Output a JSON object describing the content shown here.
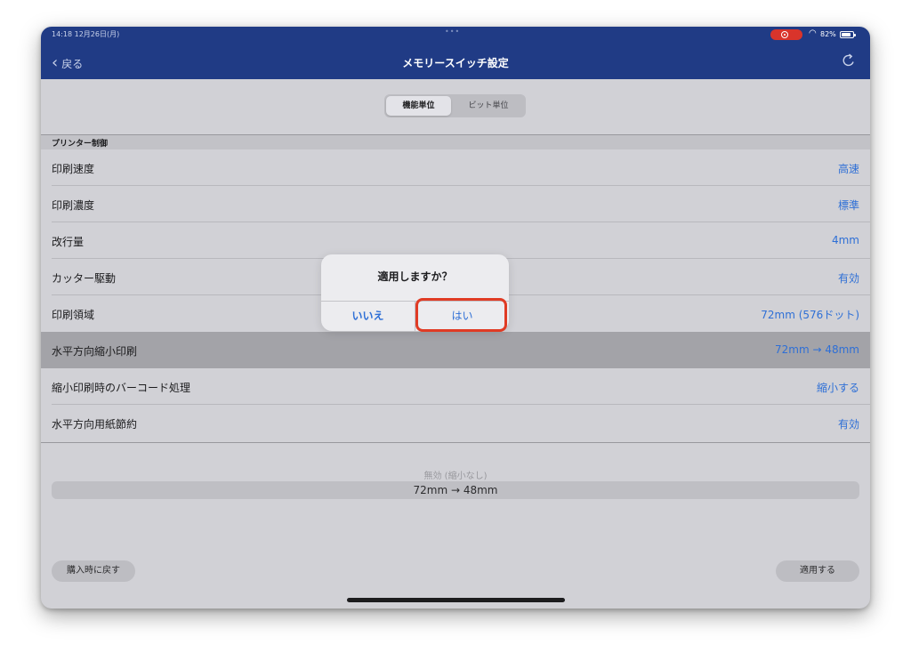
{
  "status_bar": {
    "time": "14:18  12月26日(月)",
    "dots": "•••",
    "battery": "82%"
  },
  "nav": {
    "back_label": "戻る",
    "title": "メモリースイッチ設定"
  },
  "segment": {
    "active": "機能単位",
    "inactive": "ビット単位"
  },
  "section_title": "プリンター制御",
  "rows": [
    {
      "label": "印刷速度",
      "value": "高速"
    },
    {
      "label": "印刷濃度",
      "value": "標準"
    },
    {
      "label": "改行量",
      "value": "4mm"
    },
    {
      "label": "カッター駆動",
      "value": "有効"
    },
    {
      "label": "印刷領域",
      "value": "72mm (576ドット)"
    },
    {
      "label": "水平方向縮小印刷",
      "value": "72mm → 48mm"
    },
    {
      "label": "縮小印刷時のバーコード処理",
      "value": "縮小する"
    },
    {
      "label": "水平方向用紙節約",
      "value": "有効"
    }
  ],
  "picker": {
    "faded_option": "無効 (縮小なし)",
    "selected_option": "72mm → 48mm"
  },
  "buttons": {
    "reset": "購入時に戻す",
    "apply": "適用する"
  },
  "alert": {
    "title": "適用しますか？",
    "no": "いいえ",
    "yes": "はい"
  },
  "colors": {
    "nav_bar": "#203b85",
    "accent": "#2e6fd6",
    "highlight": "#e03b24",
    "record": "#d9342b"
  },
  "battery_level": 0.82
}
